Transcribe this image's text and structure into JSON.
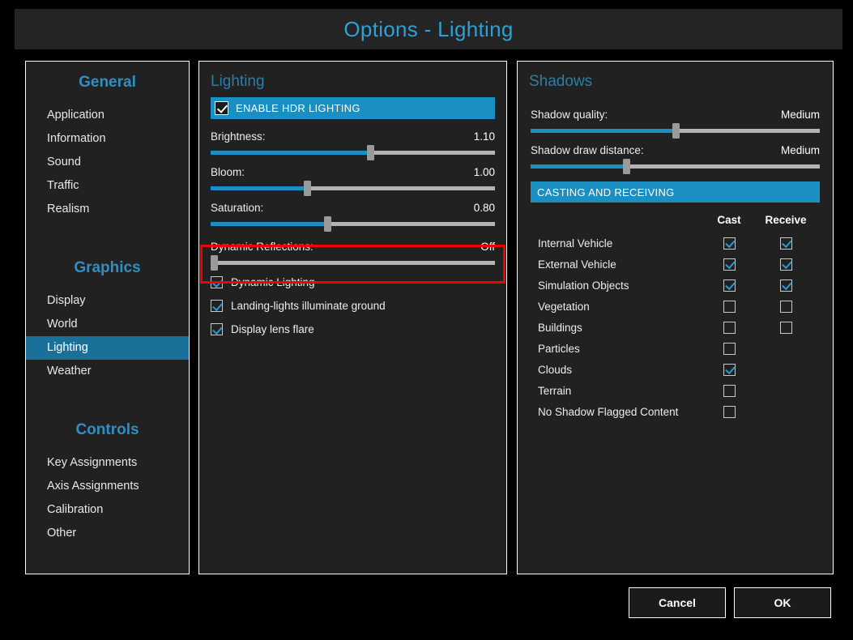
{
  "window": {
    "title": "Options - Lighting"
  },
  "sidebar": {
    "groups": [
      {
        "title": "General",
        "items": [
          {
            "label": "Application",
            "active": false
          },
          {
            "label": "Information",
            "active": false
          },
          {
            "label": "Sound",
            "active": false
          },
          {
            "label": "Traffic",
            "active": false
          },
          {
            "label": "Realism",
            "active": false
          }
        ]
      },
      {
        "title": "Graphics",
        "items": [
          {
            "label": "Display",
            "active": false
          },
          {
            "label": "World",
            "active": false
          },
          {
            "label": "Lighting",
            "active": true
          },
          {
            "label": "Weather",
            "active": false
          }
        ]
      },
      {
        "title": "Controls",
        "items": [
          {
            "label": "Key Assignments",
            "active": false
          },
          {
            "label": "Axis Assignments",
            "active": false
          },
          {
            "label": "Calibration",
            "active": false
          },
          {
            "label": "Other",
            "active": false
          }
        ]
      }
    ]
  },
  "lighting": {
    "heading": "Lighting",
    "hdr_banner": {
      "label": "ENABLE HDR LIGHTING",
      "checked": true
    },
    "sliders": [
      {
        "label": "Brightness:",
        "value": "1.10",
        "percent": 56
      },
      {
        "label": "Bloom:",
        "value": "1.00",
        "percent": 34
      },
      {
        "label": "Saturation:",
        "value": "0.80",
        "percent": 41
      }
    ],
    "reflections": {
      "label": "Dynamic Reflections:",
      "value": "Off",
      "percent": 0,
      "highlighted": true
    },
    "checkboxes": [
      {
        "label": "Dynamic Lighting",
        "checked": true
      },
      {
        "label": "Landing-lights illuminate ground",
        "checked": true
      },
      {
        "label": "Display lens flare",
        "checked": true
      }
    ]
  },
  "shadows": {
    "heading": "Shadows",
    "sliders": [
      {
        "label": "Shadow quality:",
        "value": "Medium",
        "percent": 50
      },
      {
        "label": "Shadow draw distance:",
        "value": "Medium",
        "percent": 33
      }
    ],
    "casting_banner": "CASTING AND RECEIVING",
    "table": {
      "columns": [
        "Cast",
        "Receive"
      ],
      "rows": [
        {
          "name": "Internal Vehicle",
          "cast": true,
          "receive": true,
          "has_receive": true
        },
        {
          "name": "External Vehicle",
          "cast": true,
          "receive": true,
          "has_receive": true
        },
        {
          "name": "Simulation Objects",
          "cast": true,
          "receive": true,
          "has_receive": true
        },
        {
          "name": "Vegetation",
          "cast": false,
          "receive": false,
          "has_receive": true
        },
        {
          "name": "Buildings",
          "cast": false,
          "receive": false,
          "has_receive": true
        },
        {
          "name": "Particles",
          "cast": false,
          "receive": false,
          "has_receive": false
        },
        {
          "name": "Clouds",
          "cast": true,
          "receive": false,
          "has_receive": false
        },
        {
          "name": "Terrain",
          "cast": false,
          "receive": false,
          "has_receive": false
        },
        {
          "name": "No Shadow Flagged Content",
          "cast": false,
          "receive": false,
          "has_receive": false
        }
      ]
    }
  },
  "footer": {
    "cancel_label": "Cancel",
    "ok_label": "OK"
  },
  "colors": {
    "accent_blue": "#1b8ec2",
    "title_blue": "#2f9fd4",
    "heading_blue": "#2d7ea6",
    "active_item": "#1b7099",
    "highlight_red": "#f00000",
    "panel_bg": "#212121",
    "page_bg": "#000000"
  }
}
